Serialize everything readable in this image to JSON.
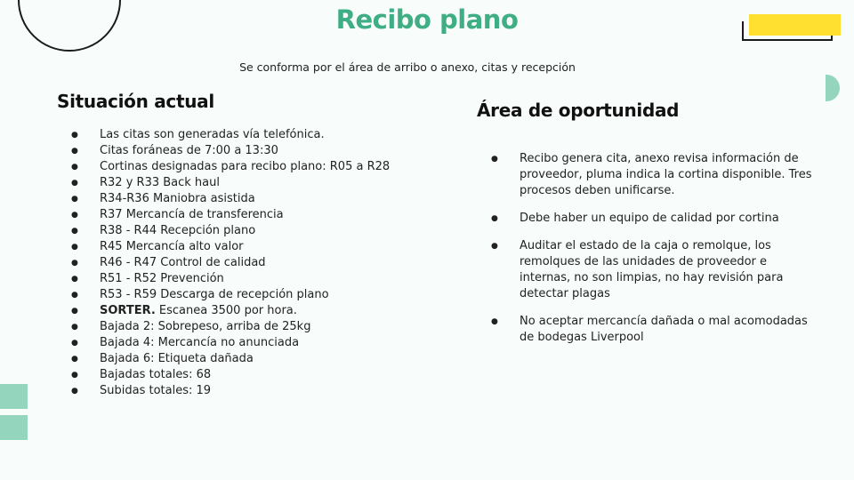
{
  "title": "Recibo plano",
  "subtitle": "Se conforma por el área de arribo o anexo, citas y recepción",
  "left": {
    "heading": "Situación actual",
    "items": [
      "Las citas son generadas vía telefónica.",
      "Citas foráneas de 7:00 a 13:30",
      "Cortinas designadas para recibo plano: R05 a R28",
      "R32 y R33 Back haul",
      "R34-R36 Maniobra asistida",
      "R37 Mercancía de transferencia",
      "R38 - R44 Recepción plano",
      "R45 Mercancía alto valor",
      "R46 - R47 Control de calidad",
      "R51 - R52 Prevención",
      "R53 - R59 Descarga de recepción plano",
      "Escanea 3500 por hora.",
      "Bajada 2: Sobrepeso, arriba de 25kg",
      "Bajada 4: Mercancía no anunciada",
      "Bajada 6: Etiqueta dañada",
      "Bajadas totales: 68",
      "Subidas totales: 19"
    ],
    "sorter_label": "SORTER."
  },
  "right": {
    "heading": "Área de oportunidad",
    "items": [
      "Recibo genera cita, anexo revisa información de proveedor, pluma indica la cortina disponible. Tres procesos deben unificarse.",
      "Debe haber un equipo de calidad por cortina",
      "Auditar el estado de la caja o remolque, los remolques de las unidades de proveedor e internas, no son limpias, no hay revisión para detectar plagas",
      "No aceptar mercancía dañada o mal acomodadas de bodegas Liverpool"
    ]
  },
  "colors": {
    "accent_green": "#3fae85",
    "light_green": "#93d6bd",
    "yellow": "#ffdf2f"
  }
}
